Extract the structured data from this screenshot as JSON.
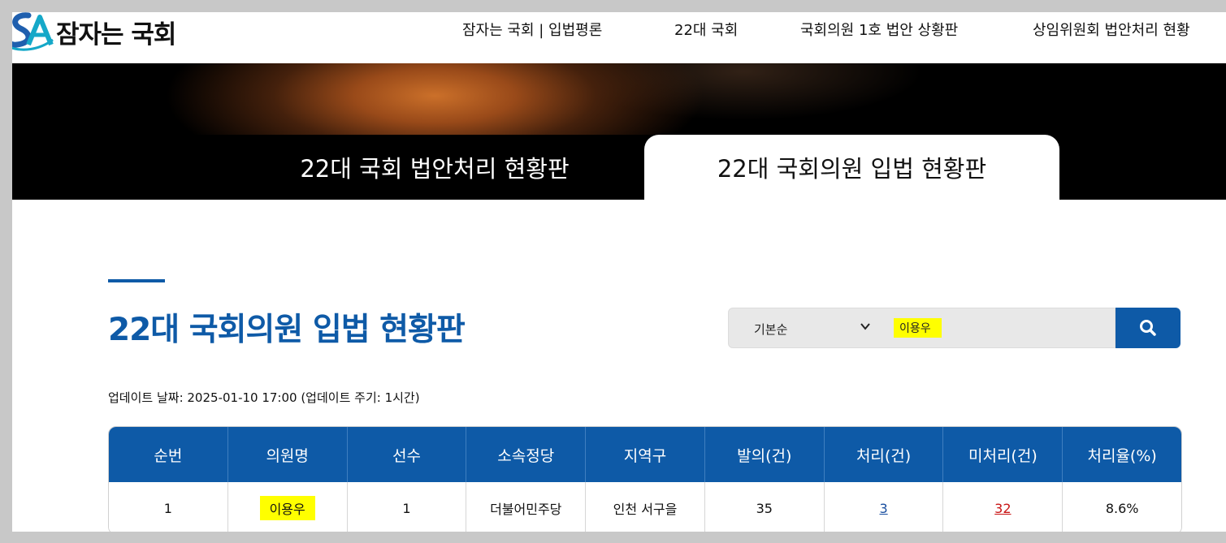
{
  "header": {
    "logo_text": "잠자는 국회",
    "nav": [
      "잠자는 국회 | 입법평론",
      "22대 국회",
      "국회의원 1호 법안 상황판",
      "상임위원회 법안처리 현황"
    ]
  },
  "tabs": [
    "22대 국회 법안처리 현황판",
    "22대 국회의원 입법 현황판"
  ],
  "main": {
    "title": "22대 국회의원 입법 현황판",
    "update_text": "업데이트 날짜: 2025-01-10 17:00 (업데이트 주기: 1시간)"
  },
  "search": {
    "sort_selected": "기본순",
    "query": "이용우"
  },
  "table": {
    "headers": [
      "순번",
      "의원명",
      "선수",
      "소속정당",
      "지역구",
      "발의(건)",
      "처리(건)",
      "미처리(건)",
      "처리율(%)"
    ],
    "rows": [
      [
        "1",
        "이용우",
        "1",
        "더불어민주당",
        "인천 서구을",
        "35",
        "3",
        "32",
        "8.6%"
      ]
    ]
  },
  "colors": {
    "primary": "#0e5aa7",
    "highlight": "#ffff00",
    "processed_link": "#1a4fa0",
    "unprocessed_link": "#c81414"
  }
}
